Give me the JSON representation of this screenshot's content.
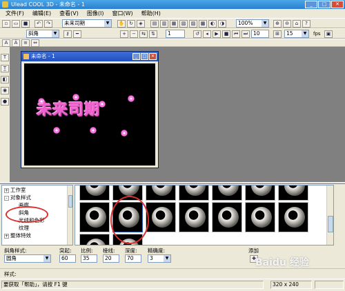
{
  "window": {
    "title": "Ulead COOL 3D - 未命名 - 1"
  },
  "menu": [
    "文件(F)",
    "编辑(E)",
    "查看(V)",
    "图像(I)",
    "窗口(W)",
    "帮助(H)"
  ],
  "toolbar1": {
    "text_field": "未来司期",
    "zoom": "100%"
  },
  "toolbar2": {
    "effect_select": "斜角",
    "frame_value": "1",
    "rate_value": "10",
    "fps_value": "15",
    "fps_label": "fps"
  },
  "document": {
    "title": "未命名 - 1",
    "art_text": "未来司期"
  },
  "tree": {
    "items": [
      {
        "label": "工作室",
        "expander": "+"
      },
      {
        "label": "对象样式",
        "expander": "-"
      },
      {
        "label": "画廊",
        "expander": ""
      },
      {
        "label": "斜角",
        "expander": ""
      },
      {
        "label": "光线和色彩",
        "expander": ""
      },
      {
        "label": "纹理",
        "expander": ""
      },
      {
        "label": "整体特效",
        "expander": "+"
      }
    ]
  },
  "properties": {
    "bevel_style_label": "斜角样式:",
    "bevel_style_value": "圆角",
    "protrude_label": "突起:",
    "protrude_value": "60",
    "scale_label": "比例:",
    "scale_value": "35",
    "edge_label": "棱线:",
    "edge_value": "20",
    "depth_label": "深度:",
    "depth_value": "70",
    "precision_label": "精确度:",
    "precision_value": "3",
    "add_label": "添加"
  },
  "style_row": {
    "label": "样式:"
  },
  "status": {
    "help_text": "要获取「帮助」，请按 F1 键",
    "size": "320 x 240"
  },
  "watermark": "Baidu 经验"
}
